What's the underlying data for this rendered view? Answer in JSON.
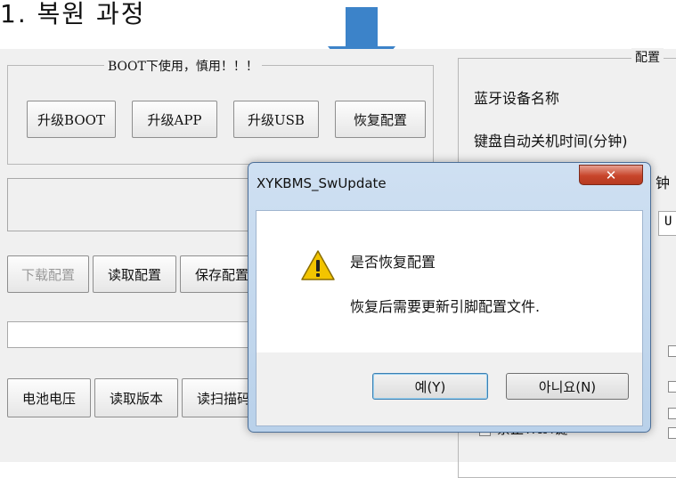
{
  "heading": "1. 복원 과정",
  "boot_group": {
    "title": "BOOT下使用，慎用！！！",
    "buttons": [
      "升级BOOT",
      "升级APP",
      "升级USB",
      "恢复配置"
    ]
  },
  "row_buttons_1": [
    "下载配置",
    "读取配置",
    "保存配置"
  ],
  "row_buttons_2": [
    "电池电压",
    "读取版本",
    "读扫描码"
  ],
  "config_group": {
    "title": "配置",
    "labels": [
      "蓝牙设备名称",
      "键盘自动关机时间(分钟)"
    ],
    "partial_label": "钟",
    "partial_field": "U",
    "checkbox_label": "禁止WIN键"
  },
  "dialog": {
    "title": "XYKBMS_SwUpdate",
    "close_glyph": "✕",
    "message_main": "是否恢复配置",
    "message_detail": "恢复后需要更新引脚配置文件.",
    "yes_button": "예(Y)",
    "no_button": "아니요(N)"
  },
  "colors": {
    "arrow": "#3c83c9",
    "warning": "#f2c400"
  }
}
